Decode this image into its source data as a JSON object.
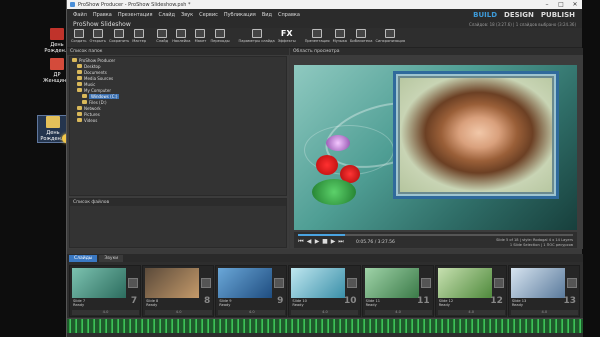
{
  "desktop": {
    "icons": [
      {
        "label": "День Рожден...",
        "color": "#c0332b"
      },
      {
        "label": "ДР Женщин...",
        "color": "#d44b3b"
      },
      {
        "label": "День Рожден...",
        "color": "#e3c05a"
      }
    ]
  },
  "app": {
    "title": "ProShow Producer - ProShow Slideshow.psh *",
    "window_controls": [
      "–",
      "□",
      "✕"
    ],
    "menu": [
      "Файл",
      "Правка",
      "Презентация",
      "Слайд",
      "Звук",
      "Сервис",
      "Публикация",
      "Вид",
      "Справка"
    ],
    "modes": [
      {
        "label": "BUILD",
        "active": true
      },
      {
        "label": "DESIGN",
        "active": false
      },
      {
        "label": "PUBLISH",
        "active": false
      }
    ],
    "project_name": "ProShow Slideshow",
    "project_info": "Слайдов: 18 (3:27.6) | 1 слайдов выбрано (3:24.36)",
    "toolbar": [
      {
        "label": "Создать",
        "icon": "new-icon"
      },
      {
        "label": "Открыть",
        "icon": "open-icon"
      },
      {
        "label": "Сохранить",
        "icon": "save-icon"
      },
      {
        "label": "Мастер",
        "icon": "wizard-icon"
      },
      {
        "label": "Слайд",
        "icon": "slide-icon"
      },
      {
        "label": "Наклейка",
        "icon": "caption-icon"
      },
      {
        "label": "Макет",
        "icon": "layout-icon"
      },
      {
        "label": "Переходы",
        "icon": "transition-icon"
      },
      {
        "label": "Параметры слайда",
        "icon": "slide-options-icon"
      },
      {
        "label": "Эффекты",
        "icon": "fx-icon",
        "text": "FX"
      },
      {
        "label": "Презентация",
        "icon": "show-icon"
      },
      {
        "label": "Музыка",
        "icon": "music-icon"
      },
      {
        "label": "Библиотека",
        "icon": "library-icon"
      },
      {
        "label": "Синхронизация",
        "icon": "sync-icon"
      }
    ],
    "folders_panel": {
      "title": "Список папок",
      "items": [
        {
          "label": "ProShow Producer",
          "indent": 0
        },
        {
          "label": "Desktop",
          "indent": 1
        },
        {
          "label": "Documents",
          "indent": 1
        },
        {
          "label": "Media Sources",
          "indent": 1
        },
        {
          "label": "Music",
          "indent": 1
        },
        {
          "label": "My Computer",
          "indent": 1
        },
        {
          "label": "Windows (C:)",
          "indent": 2,
          "highlighted": true
        },
        {
          "label": "Files (D:)",
          "indent": 2
        },
        {
          "label": "Network",
          "indent": 1
        },
        {
          "label": "Pictures",
          "indent": 1
        },
        {
          "label": "Videos",
          "indent": 1
        }
      ]
    },
    "files_panel": {
      "title": "Список файлов"
    },
    "preview": {
      "title": "Область просмотра",
      "timecode": "0:05.76 / 3:27.56",
      "progress": 0.17,
      "slide_info_1": "Slide 5 of 18 | style: Rodagal 4 x 14 Layers",
      "slide_info_2": "1 Slide Selection | 1 ПОС ресурсов"
    },
    "strip": {
      "tabs": [
        {
          "label": "Слайды",
          "active": true
        },
        {
          "label": "Звуки",
          "active": false
        }
      ],
      "slides": [
        {
          "name": "Slide 7",
          "num": "7",
          "time": "4.0",
          "sub": "Ready",
          "thumb": "linear-gradient(135deg,#7cc2b0,#2c6c5e)"
        },
        {
          "name": "Slide 8",
          "num": "8",
          "time": "4.0",
          "sub": "Ready",
          "thumb": "linear-gradient(135deg,#5b4a3a,#c49a6a)"
        },
        {
          "name": "Slide 9",
          "num": "9",
          "time": "4.0",
          "sub": "Ready",
          "thumb": "linear-gradient(135deg,#6aa7d8,#1f4d80)"
        },
        {
          "name": "Slide 10",
          "num": "10",
          "time": "4.0",
          "sub": "Ready",
          "thumb": "linear-gradient(135deg,#bfe7f0,#3a8fa8)"
        },
        {
          "name": "Slide 11",
          "num": "11",
          "time": "4.0",
          "sub": "Ready",
          "thumb": "linear-gradient(135deg,#9fd3a8,#3b7a48)"
        },
        {
          "name": "Slide 12",
          "num": "12",
          "time": "4.0",
          "sub": "Ready",
          "thumb": "linear-gradient(135deg,#c7e0b0,#4f8a3c)"
        },
        {
          "name": "Slide 13",
          "num": "13",
          "time": "4.0",
          "sub": "Ready",
          "thumb": "linear-gradient(135deg,#d7e4f0,#5a7a9c)"
        }
      ]
    }
  }
}
